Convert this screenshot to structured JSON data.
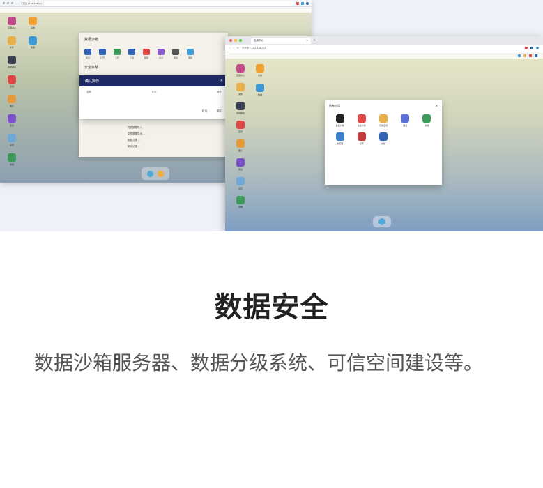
{
  "hero": {
    "back_window": {
      "url_text": "不安全 | 192.168.x.x",
      "tab_text": "",
      "desktop_icons": [
        {
          "label": "应用中心",
          "color": "#c34b8a"
        },
        {
          "label": "文件",
          "color": "#e8b04a"
        },
        {
          "label": "控制面板",
          "color": "#3a3f52"
        },
        {
          "label": "应用",
          "color": "#e04848"
        },
        {
          "label": "图片",
          "color": "#e59a3a"
        },
        {
          "label": "安全",
          "color": "#7b52c9"
        },
        {
          "label": "设置",
          "color": "#6fa8d6"
        },
        {
          "label": "终端",
          "color": "#3d9a5b"
        }
      ],
      "desktop_icons_col2": [
        {
          "label": "系统",
          "color": "#f0a030"
        },
        {
          "label": "数据",
          "color": "#3d9ad6"
        }
      ],
      "file_manager": {
        "title": "数据沙箱",
        "section": "安全策略",
        "tools": [
          {
            "label": "新建",
            "color": "#3462b3"
          },
          {
            "label": "打开",
            "color": "#3462b3"
          },
          {
            "label": "上传",
            "color": "#3d9a5b"
          },
          {
            "label": "下载",
            "color": "#3462b3"
          },
          {
            "label": "删除",
            "color": "#e04848"
          },
          {
            "label": "共享",
            "color": "#8a5bc9"
          },
          {
            "label": "属性",
            "color": "#555555"
          },
          {
            "label": "刷新",
            "color": "#3d9ad6"
          }
        ],
        "rows": [
          "文件数据导入 ...",
          "文件数据导出 ...",
          "数据共享 ...",
          "审计记录 ..."
        ]
      },
      "dialog": {
        "title": "确认操作",
        "cols": [
          "名称",
          "状态",
          "操作"
        ],
        "buttons": [
          "取消",
          "确定"
        ]
      }
    },
    "front_window": {
      "tab_label": "应用中心",
      "url_text": "不安全 | 192.168.x.x",
      "desktop_icons": [
        {
          "label": "应用中心",
          "color": "#c34b8a"
        },
        {
          "label": "文件",
          "color": "#e8b04a"
        },
        {
          "label": "控制面板",
          "color": "#3a3f52"
        },
        {
          "label": "应用",
          "color": "#e04848"
        },
        {
          "label": "图片",
          "color": "#e59a3a"
        },
        {
          "label": "安全",
          "color": "#7b52c9"
        },
        {
          "label": "设置",
          "color": "#6fa8d6"
        },
        {
          "label": "终端",
          "color": "#3d9a5b"
        }
      ],
      "desktop_icons_col2": [
        {
          "label": "系统",
          "color": "#f0a030"
        },
        {
          "label": "数据",
          "color": "#3d9ad6"
        }
      ],
      "app_window": {
        "title": "所有应用",
        "apps": [
          {
            "label": "数据沙箱",
            "color": "#222222"
          },
          {
            "label": "数据分级",
            "color": "#e04848"
          },
          {
            "label": "可信空间",
            "color": "#e8b04a"
          },
          {
            "label": "建设",
            "color": "#5b6fd6"
          },
          {
            "label": "系统",
            "color": "#3d9a5b"
          },
          {
            "label": "浏览器",
            "color": "#3d7fc9"
          },
          {
            "label": "记录",
            "color": "#c33b3b"
          },
          {
            "label": "文档",
            "color": "#3462b3"
          }
        ]
      }
    }
  },
  "heading": "数据安全",
  "description": "数据沙箱服务器、数据分级系统、可信空间建设等。"
}
